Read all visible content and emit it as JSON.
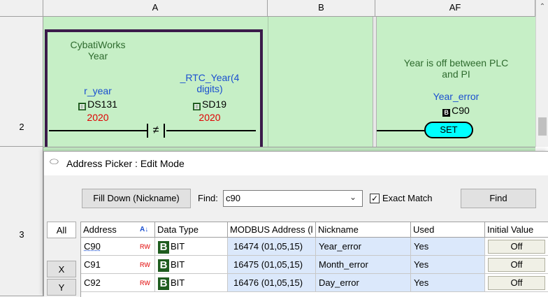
{
  "columns": {
    "a": "A",
    "b": "B",
    "af": "AF"
  },
  "rows": {
    "r2": "2",
    "r3": "3"
  },
  "rung": {
    "contact1_comment": [
      "CybatiWorks",
      "Year"
    ],
    "contact1_nick": "r_year",
    "contact1_addr": "DS131",
    "contact1_value": "2020",
    "contact_symbol": "≠",
    "contact2_nick": [
      "_RTC_Year(4",
      "digits)"
    ],
    "contact2_addr": "SD19",
    "contact2_value": "2020",
    "coil_comment": [
      "Year is off between PLC",
      "and PI"
    ],
    "coil_nick": "Year_error",
    "coil_addr": "C90",
    "coil_label": "SET"
  },
  "dialog": {
    "title": "Address Picker : Edit Mode",
    "fill_down_label": "Fill Down (Nickname)",
    "find_label": "Find:",
    "find_value": "c90",
    "exact_match_label": "Exact Match",
    "exact_match_checked": true,
    "find_button": "Find",
    "side_all": "All",
    "side_x": "X",
    "side_y": "Y",
    "headers": [
      "Address",
      "Data Type",
      "MODBUS Address (l",
      "Nickname",
      "Used",
      "Initial Value"
    ],
    "rows": [
      {
        "address": "C90",
        "rw": "RW",
        "type": "BIT",
        "modbus": "16474 (01,05,15)",
        "nickname": "Year_error",
        "used": "Yes",
        "initial": "Off"
      },
      {
        "address": "C91",
        "rw": "RW",
        "type": "BIT",
        "modbus": "16475 (01,05,15)",
        "nickname": "Month_error",
        "used": "Yes",
        "initial": "Off"
      },
      {
        "address": "C92",
        "rw": "RW",
        "type": "BIT",
        "modbus": "16476 (01,05,15)",
        "nickname": "Day_error",
        "used": "Yes",
        "initial": "Off"
      }
    ]
  },
  "colors": {
    "ladder_bg": "#c6efc6",
    "selection": "#3b1a4a",
    "blue_fill": "#dbe8fb",
    "coil": "#00ffff"
  }
}
